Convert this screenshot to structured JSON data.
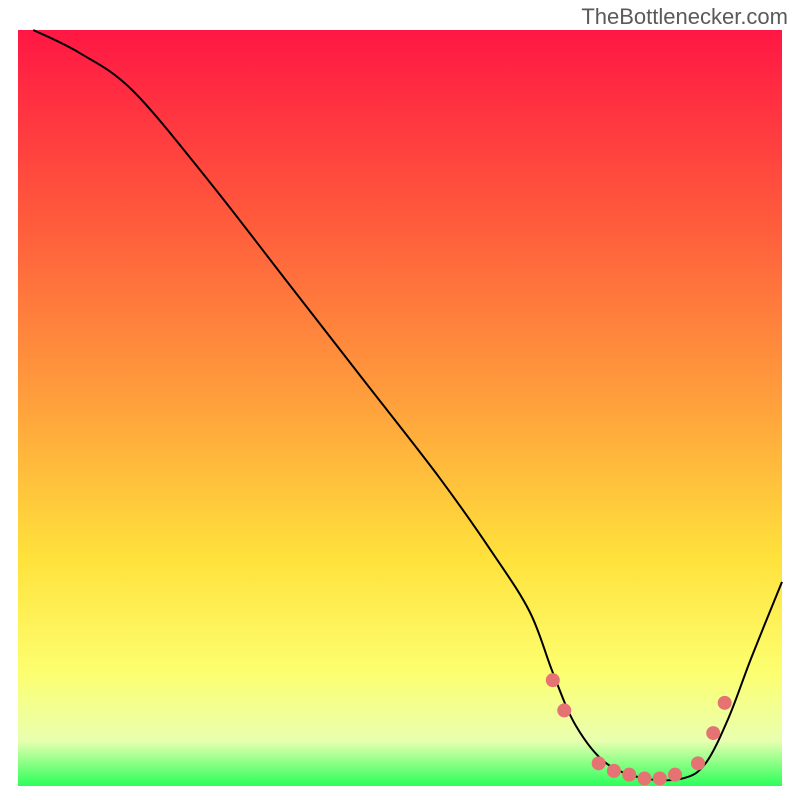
{
  "watermark": "TheBottlenecker.com",
  "chart_data": {
    "type": "line",
    "title": "",
    "xlabel": "",
    "ylabel": "",
    "xlim": [
      0,
      100
    ],
    "ylim": [
      0,
      100
    ],
    "background": {
      "type": "vertical-gradient",
      "stops": [
        {
          "offset": 0,
          "color": "#ff1744"
        },
        {
          "offset": 25,
          "color": "#ff5a3c"
        },
        {
          "offset": 50,
          "color": "#ffa23c"
        },
        {
          "offset": 70,
          "color": "#ffe23c"
        },
        {
          "offset": 85,
          "color": "#fdff70"
        },
        {
          "offset": 94,
          "color": "#e9ffb0"
        },
        {
          "offset": 100,
          "color": "#2bff5a"
        }
      ]
    },
    "series": [
      {
        "name": "bottleneck-curve",
        "color": "#000000",
        "stroke_width": 2,
        "x": [
          2,
          8,
          15,
          25,
          35,
          45,
          55,
          62,
          67,
          70,
          73,
          77,
          82,
          87,
          90,
          93,
          96,
          100
        ],
        "y": [
          100,
          97,
          92,
          80,
          67,
          54,
          41,
          31,
          23,
          15,
          8,
          3,
          1,
          1,
          3,
          9,
          17,
          27
        ]
      }
    ],
    "markers": {
      "name": "highlight-dots",
      "color": "#e57373",
      "radius": 7,
      "points": [
        {
          "x": 70,
          "y": 14
        },
        {
          "x": 71.5,
          "y": 10
        },
        {
          "x": 76,
          "y": 3
        },
        {
          "x": 78,
          "y": 2
        },
        {
          "x": 80,
          "y": 1.5
        },
        {
          "x": 82,
          "y": 1
        },
        {
          "x": 84,
          "y": 1
        },
        {
          "x": 86,
          "y": 1.5
        },
        {
          "x": 89,
          "y": 3
        },
        {
          "x": 91,
          "y": 7
        },
        {
          "x": 92.5,
          "y": 11
        }
      ]
    }
  }
}
